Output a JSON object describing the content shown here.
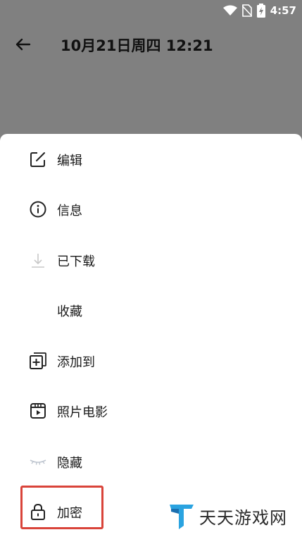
{
  "status_bar": {
    "time": "4:57",
    "icons": [
      "wifi-icon",
      "no-sim-icon",
      "battery-icon"
    ]
  },
  "header": {
    "title": "10月21日周四 12:21",
    "back_icon": "arrow-left-icon"
  },
  "menu": {
    "items": [
      {
        "label": "编辑",
        "icon": "edit-icon"
      },
      {
        "label": "信息",
        "icon": "info-icon"
      },
      {
        "label": "已下载",
        "icon": "download-icon"
      },
      {
        "label": "收藏",
        "icon": ""
      },
      {
        "label": "添加到",
        "icon": "add-to-album-icon"
      },
      {
        "label": "照片电影",
        "icon": "photo-movie-icon"
      },
      {
        "label": "隐藏",
        "icon": "closed-eye-icon"
      },
      {
        "label": "加密",
        "icon": "lock-icon"
      }
    ]
  },
  "watermark": {
    "text": "天天游戏网",
    "logo": "t-logo-icon"
  },
  "colors": {
    "dim_overlay": "#808080",
    "sheet": "#ffffff",
    "highlight_border": "#d9443a",
    "logo_blue": "#2aa3e0"
  }
}
